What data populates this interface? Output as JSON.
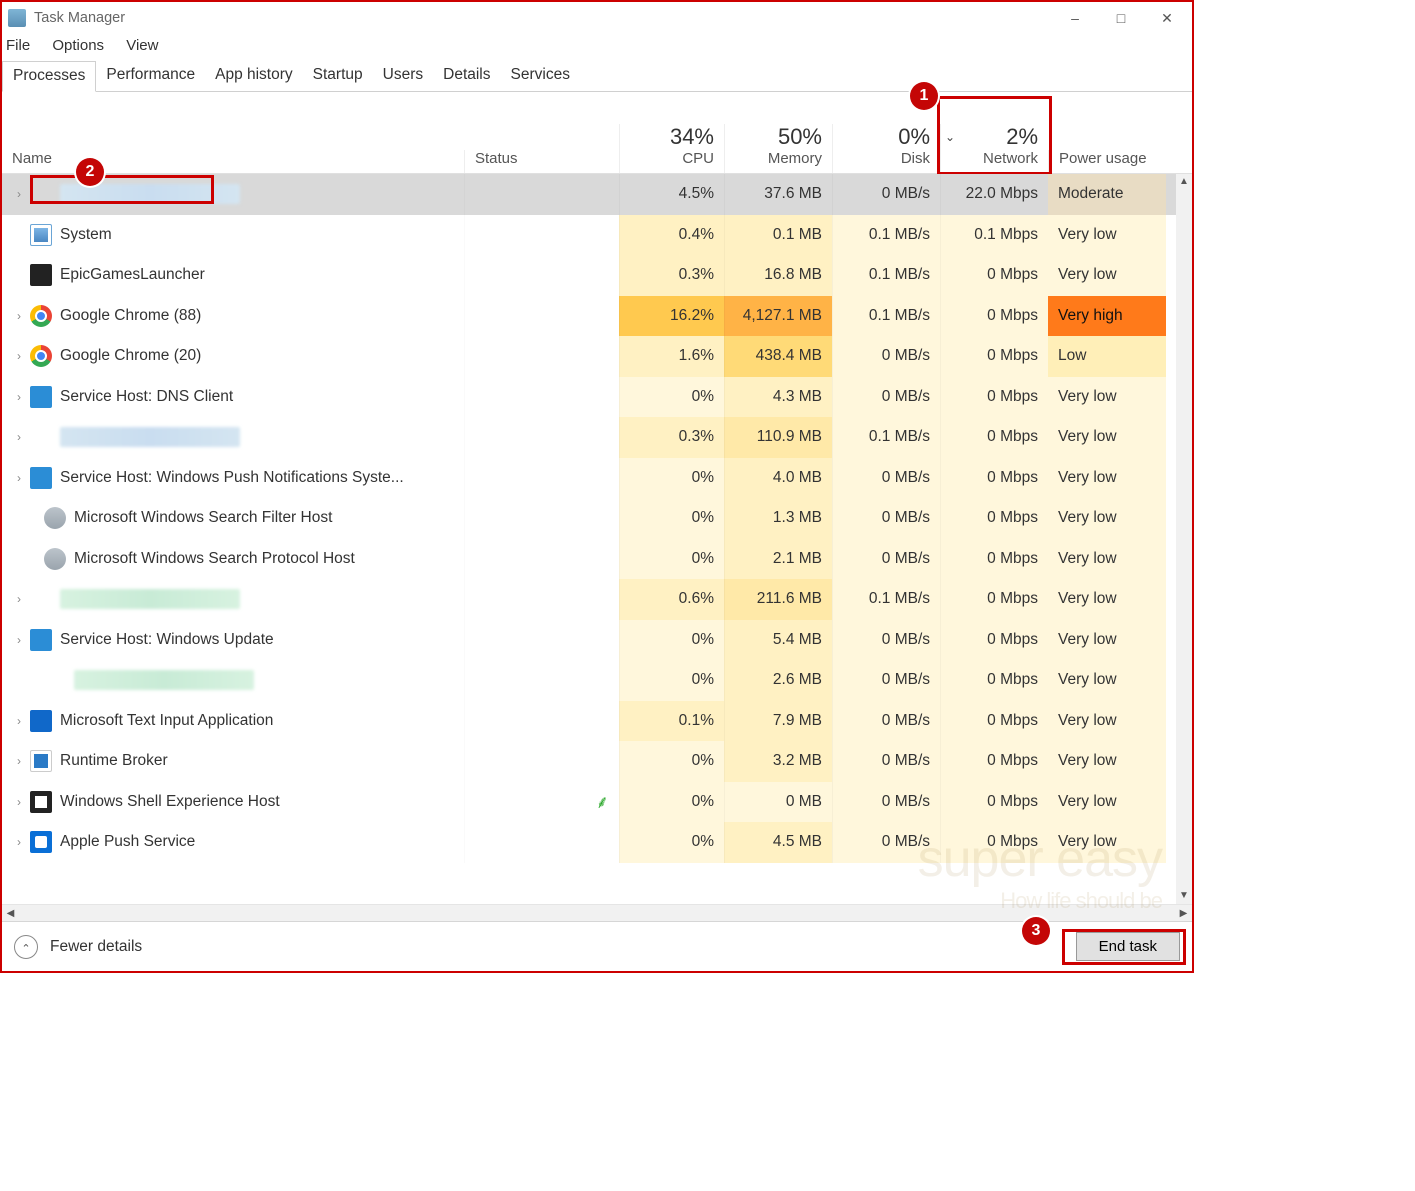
{
  "window": {
    "title": "Task Manager"
  },
  "menubar": [
    "File",
    "Options",
    "View"
  ],
  "tabs": [
    "Processes",
    "Performance",
    "App history",
    "Startup",
    "Users",
    "Details",
    "Services"
  ],
  "active_tab": 0,
  "columns": {
    "name": "Name",
    "status": "Status",
    "cpu": {
      "value": "34%",
      "label": "CPU"
    },
    "memory": {
      "value": "50%",
      "label": "Memory"
    },
    "disk": {
      "value": "0%",
      "label": "Disk"
    },
    "network": {
      "value": "2%",
      "label": "Network"
    },
    "power": "Power usage"
  },
  "sort_column": "network",
  "rows": [
    {
      "name": "",
      "blurred": "blue",
      "expand": true,
      "selected": true,
      "highlight_name": true,
      "cpu": "4.5%",
      "cpu_h": 1,
      "mem": "37.6 MB",
      "mem_h": 1,
      "disk": "0 MB/s",
      "disk_h": 0,
      "net": "22.0 Mbps",
      "net_h": 1,
      "power": "Moderate",
      "power_h": "mod",
      "icon": ""
    },
    {
      "name": "System",
      "expand": false,
      "icon": "system",
      "cpu": "0.4%",
      "cpu_h": 1,
      "mem": "0.1 MB",
      "mem_h": 1,
      "disk": "0.1 MB/s",
      "disk_h": 0,
      "net": "0.1 Mbps",
      "net_h": 0,
      "power": "Very low",
      "power_h": "vlow"
    },
    {
      "name": "EpicGamesLauncher",
      "expand": false,
      "icon": "epic",
      "cpu": "0.3%",
      "cpu_h": 1,
      "mem": "16.8 MB",
      "mem_h": 1,
      "disk": "0.1 MB/s",
      "disk_h": 0,
      "net": "0 Mbps",
      "net_h": 0,
      "power": "Very low",
      "power_h": "vlow"
    },
    {
      "name": "Google Chrome (88)",
      "expand": true,
      "icon": "chrome",
      "cpu": "16.2%",
      "cpu_h": 4,
      "mem": "4,127.1 MB",
      "mem_h": 5,
      "disk": "0.1 MB/s",
      "disk_h": 0,
      "net": "0 Mbps",
      "net_h": 0,
      "power": "Very high",
      "power_h": "vhigh"
    },
    {
      "name": "Google Chrome (20)",
      "expand": true,
      "icon": "chrome",
      "cpu": "1.6%",
      "cpu_h": 1,
      "mem": "438.4 MB",
      "mem_h": 3,
      "disk": "0 MB/s",
      "disk_h": 0,
      "net": "0 Mbps",
      "net_h": 0,
      "power": "Low",
      "power_h": "low"
    },
    {
      "name": "Service Host: DNS Client",
      "expand": true,
      "icon": "gear",
      "cpu": "0%",
      "cpu_h": 0,
      "mem": "4.3 MB",
      "mem_h": 1,
      "disk": "0 MB/s",
      "disk_h": 0,
      "net": "0 Mbps",
      "net_h": 0,
      "power": "Very low",
      "power_h": "vlow"
    },
    {
      "name": "",
      "blurred": "blue",
      "expand": true,
      "icon": "",
      "cpu": "0.3%",
      "cpu_h": 1,
      "mem": "110.9 MB",
      "mem_h": 2,
      "disk": "0.1 MB/s",
      "disk_h": 0,
      "net": "0 Mbps",
      "net_h": 0,
      "power": "Very low",
      "power_h": "vlow"
    },
    {
      "name": "Service Host: Windows Push Notifications Syste...",
      "expand": true,
      "icon": "gear",
      "cpu": "0%",
      "cpu_h": 0,
      "mem": "4.0 MB",
      "mem_h": 1,
      "disk": "0 MB/s",
      "disk_h": 0,
      "net": "0 Mbps",
      "net_h": 0,
      "power": "Very low",
      "power_h": "vlow"
    },
    {
      "name": "Microsoft Windows Search Filter Host",
      "expand": false,
      "icon": "search",
      "indent": true,
      "cpu": "0%",
      "cpu_h": 0,
      "mem": "1.3 MB",
      "mem_h": 1,
      "disk": "0 MB/s",
      "disk_h": 0,
      "net": "0 Mbps",
      "net_h": 0,
      "power": "Very low",
      "power_h": "vlow"
    },
    {
      "name": "Microsoft Windows Search Protocol Host",
      "expand": false,
      "icon": "search",
      "indent": true,
      "cpu": "0%",
      "cpu_h": 0,
      "mem": "2.1 MB",
      "mem_h": 1,
      "disk": "0 MB/s",
      "disk_h": 0,
      "net": "0 Mbps",
      "net_h": 0,
      "power": "Very low",
      "power_h": "vlow"
    },
    {
      "name": "",
      "blurred": "green",
      "expand": true,
      "icon": "",
      "cpu": "0.6%",
      "cpu_h": 1,
      "mem": "211.6 MB",
      "mem_h": 2,
      "disk": "0.1 MB/s",
      "disk_h": 0,
      "net": "0 Mbps",
      "net_h": 0,
      "power": "Very low",
      "power_h": "vlow"
    },
    {
      "name": "Service Host: Windows Update",
      "expand": true,
      "icon": "gear",
      "cpu": "0%",
      "cpu_h": 0,
      "mem": "5.4 MB",
      "mem_h": 1,
      "disk": "0 MB/s",
      "disk_h": 0,
      "net": "0 Mbps",
      "net_h": 0,
      "power": "Very low",
      "power_h": "vlow"
    },
    {
      "name": "",
      "blurred": "green",
      "expand": false,
      "icon": "",
      "indent": true,
      "cpu": "0%",
      "cpu_h": 0,
      "mem": "2.6 MB",
      "mem_h": 1,
      "disk": "0 MB/s",
      "disk_h": 0,
      "net": "0 Mbps",
      "net_h": 0,
      "power": "Very low",
      "power_h": "vlow"
    },
    {
      "name": "Microsoft Text Input Application",
      "expand": true,
      "icon": "textinput",
      "cpu": "0.1%",
      "cpu_h": 1,
      "mem": "7.9 MB",
      "mem_h": 1,
      "disk": "0 MB/s",
      "disk_h": 0,
      "net": "0 Mbps",
      "net_h": 0,
      "power": "Very low",
      "power_h": "vlow"
    },
    {
      "name": "Runtime Broker",
      "expand": true,
      "icon": "runtime",
      "cpu": "0%",
      "cpu_h": 0,
      "mem": "3.2 MB",
      "mem_h": 1,
      "disk": "0 MB/s",
      "disk_h": 0,
      "net": "0 Mbps",
      "net_h": 0,
      "power": "Very low",
      "power_h": "vlow"
    },
    {
      "name": "Windows Shell Experience Host",
      "expand": true,
      "icon": "shell",
      "leaf": true,
      "cpu": "0%",
      "cpu_h": 0,
      "mem": "0 MB",
      "mem_h": 0,
      "disk": "0 MB/s",
      "disk_h": 0,
      "net": "0 Mbps",
      "net_h": 0,
      "power": "Very low",
      "power_h": "vlow"
    },
    {
      "name": "Apple Push Service",
      "expand": true,
      "icon": "apple",
      "cpu": "0%",
      "cpu_h": 0,
      "mem": "4.5 MB",
      "mem_h": 1,
      "disk": "0 MB/s",
      "disk_h": 0,
      "net": "0 Mbps",
      "net_h": 0,
      "power": "Very low",
      "power_h": "vlow"
    }
  ],
  "footer": {
    "fewer": "Fewer details",
    "endtask": "End task"
  },
  "markers": {
    "1": "1",
    "2": "2",
    "3": "3"
  },
  "watermark": {
    "main": "super easy",
    "sub": "How life should be"
  }
}
